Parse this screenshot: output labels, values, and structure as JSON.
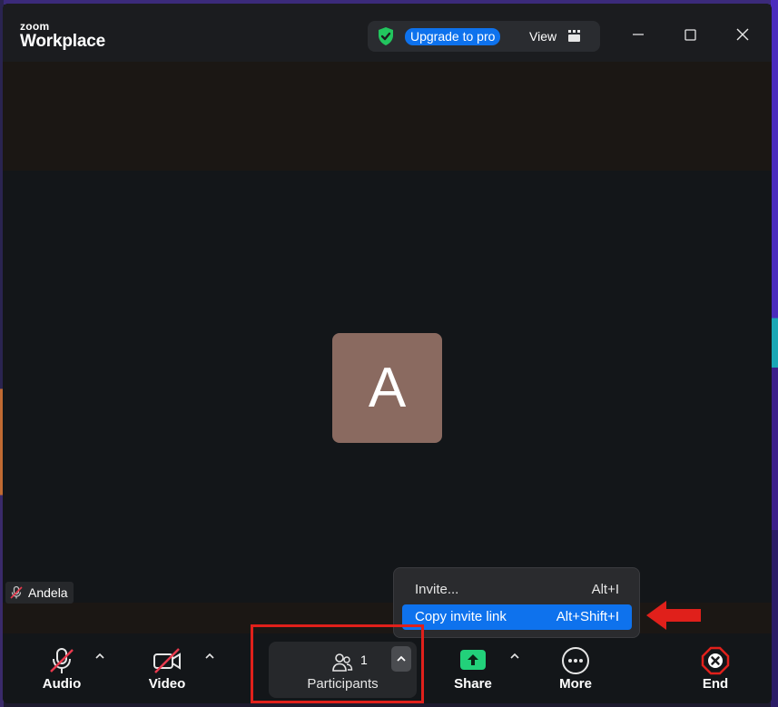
{
  "app": {
    "logo_top": "zoom",
    "logo_bottom": "Workplace"
  },
  "titlebar": {
    "upgrade_label": "Upgrade to pro",
    "view_label": "View"
  },
  "participant": {
    "avatar_initial": "A",
    "name": "Andela"
  },
  "popup_menu": {
    "items": [
      {
        "label": "Invite...",
        "shortcut": "Alt+I"
      },
      {
        "label": "Copy invite link",
        "shortcut": "Alt+Shift+I"
      }
    ]
  },
  "toolbar": {
    "audio_label": "Audio",
    "video_label": "Video",
    "participants_label": "Participants",
    "participants_count": "1",
    "share_label": "Share",
    "more_label": "More",
    "end_label": "End"
  },
  "colors": {
    "accent_blue": "#0e72ed",
    "share_green": "#22d17a",
    "end_red": "#e0201b",
    "muted_red": "#e8394d",
    "annotation_red": "#e0201b"
  }
}
